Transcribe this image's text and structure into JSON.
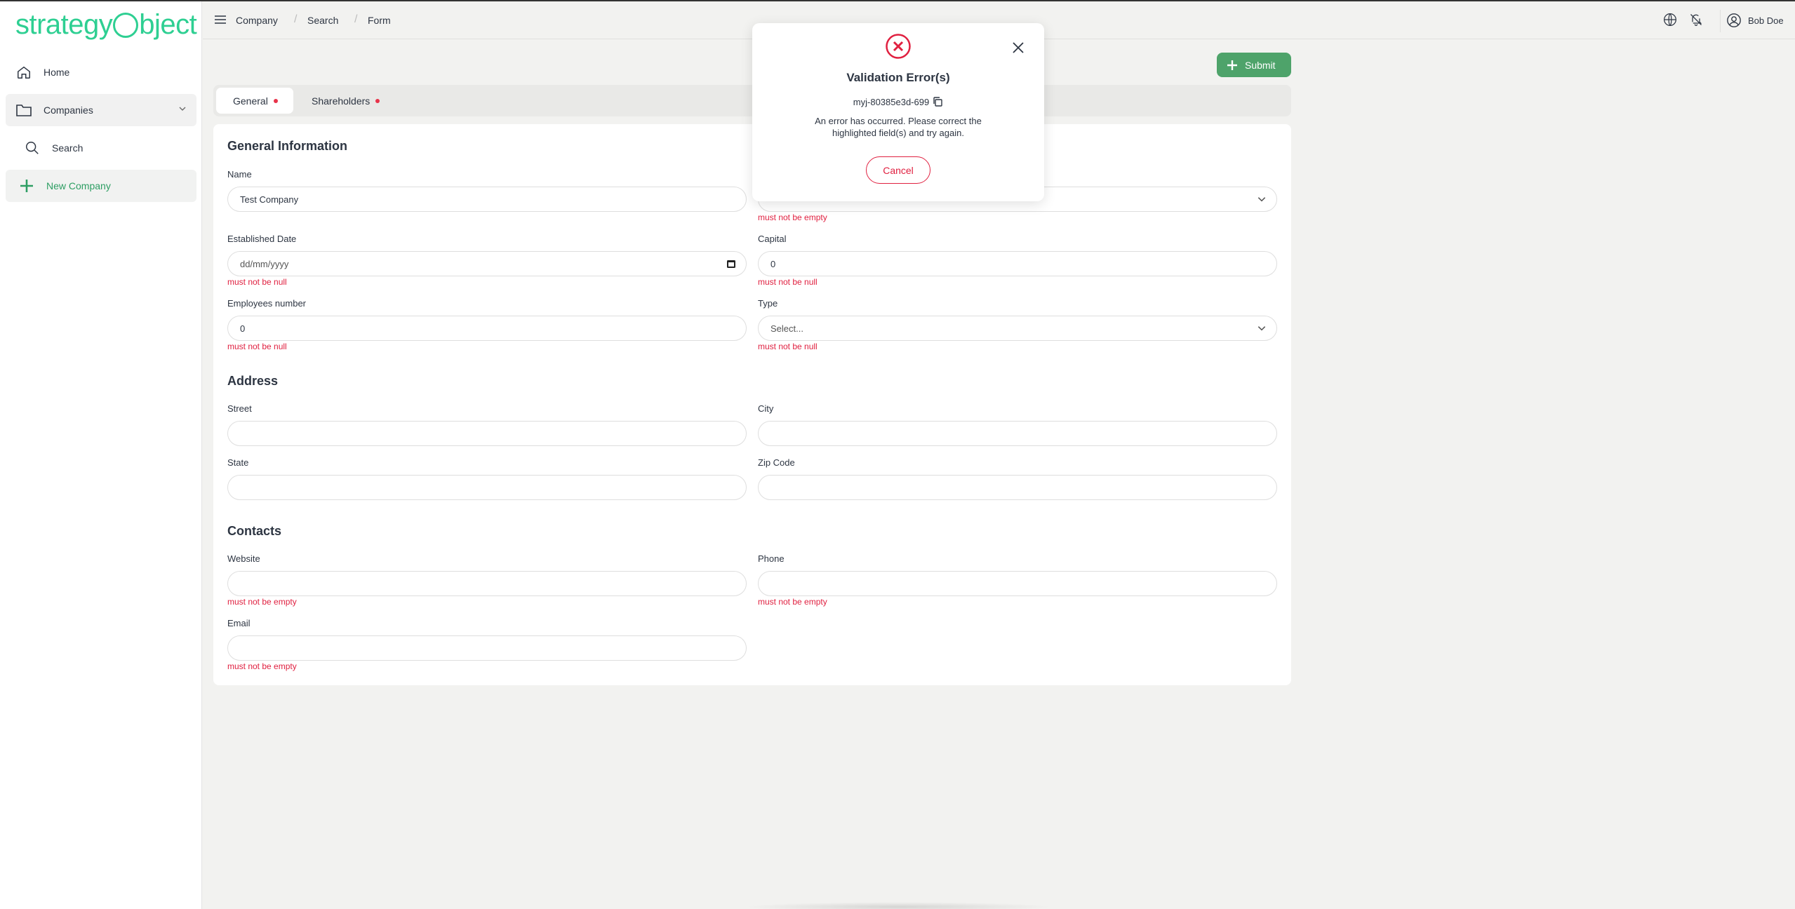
{
  "app": {
    "logo_text_left": "strategy",
    "logo_text_right": "bject",
    "accent_color": "#2ecf92",
    "primary_button_color": "#4ea36a",
    "error_color": "#e02040"
  },
  "sidebar": {
    "items": [
      {
        "label": "Home",
        "icon": "home-icon"
      },
      {
        "label": "Companies",
        "icon": "folder-icon"
      },
      {
        "label": "Search",
        "icon": "search-icon"
      },
      {
        "label": "New Company",
        "icon": "plus-icon"
      }
    ]
  },
  "header": {
    "breadcrumbs": [
      "Company",
      "Search",
      "Form"
    ],
    "user_name": "Bob Doe",
    "icons": [
      "globe-icon",
      "notifications-off-icon",
      "user-circle-icon"
    ]
  },
  "toolbar": {
    "submit_label": "Submit"
  },
  "tabs": [
    {
      "label": "General",
      "active": true,
      "has_error": true
    },
    {
      "label": "Shareholders",
      "active": false,
      "has_error": true
    }
  ],
  "form": {
    "general": {
      "title": "General Information",
      "name": {
        "label": "Name",
        "value": "Test Company"
      },
      "name_right_error": "must not be empty",
      "established_date": {
        "label": "Established Date",
        "placeholder": "dd/mm/yyyy",
        "error": "must not be null"
      },
      "capital": {
        "label": "Capital",
        "value": "0",
        "error": "must not be null"
      },
      "employees": {
        "label": "Employees number",
        "value": "0",
        "error": "must not be null"
      },
      "type": {
        "label": "Type",
        "placeholder": "Select...",
        "error": "must not be null"
      }
    },
    "address": {
      "title": "Address",
      "street": {
        "label": "Street",
        "value": ""
      },
      "city": {
        "label": "City",
        "value": ""
      },
      "state": {
        "label": "State",
        "value": ""
      },
      "zip": {
        "label": "Zip Code",
        "value": ""
      }
    },
    "contacts": {
      "title": "Contacts",
      "website": {
        "label": "Website",
        "value": "",
        "error": "must not be empty"
      },
      "phone": {
        "label": "Phone",
        "value": "",
        "error": "must not be empty"
      },
      "email": {
        "label": "Email",
        "value": "",
        "error": "must not be empty"
      }
    }
  },
  "modal": {
    "title": "Validation Error(s)",
    "code": "myj-80385e3d-699",
    "message": "An error has occurred. Please correct the highlighted field(s) and try again.",
    "cancel_label": "Cancel"
  }
}
